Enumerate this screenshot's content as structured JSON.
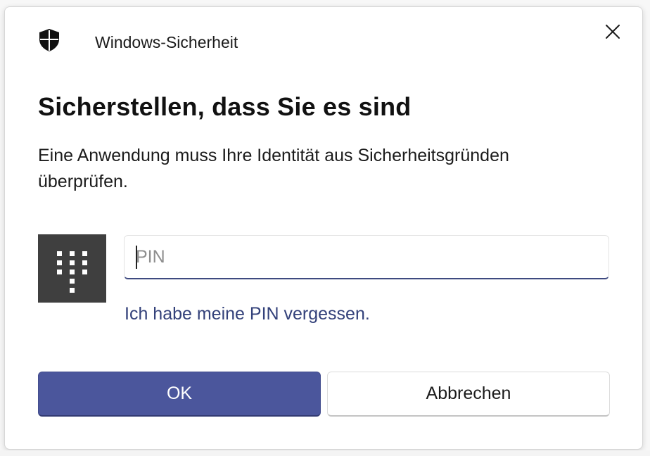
{
  "dialog": {
    "app_title": "Windows-Sicherheit",
    "heading": "Sicherstellen, dass Sie es sind",
    "description": "Eine Anwendung muss Ihre Identität aus Sicherheitsgründen überprüfen.",
    "pin_input": {
      "value": "",
      "placeholder": "PIN"
    },
    "forgot_pin_link": "Ich habe meine PIN vergessen.",
    "ok_button": "OK",
    "cancel_button": "Abbrechen"
  },
  "icons": {
    "app": "shield-icon",
    "close": "close-icon",
    "keypad": "keypad-icon"
  },
  "colors": {
    "accent": "#4b569c",
    "link": "#33417a",
    "keypad_tile": "#3f3f3f"
  }
}
